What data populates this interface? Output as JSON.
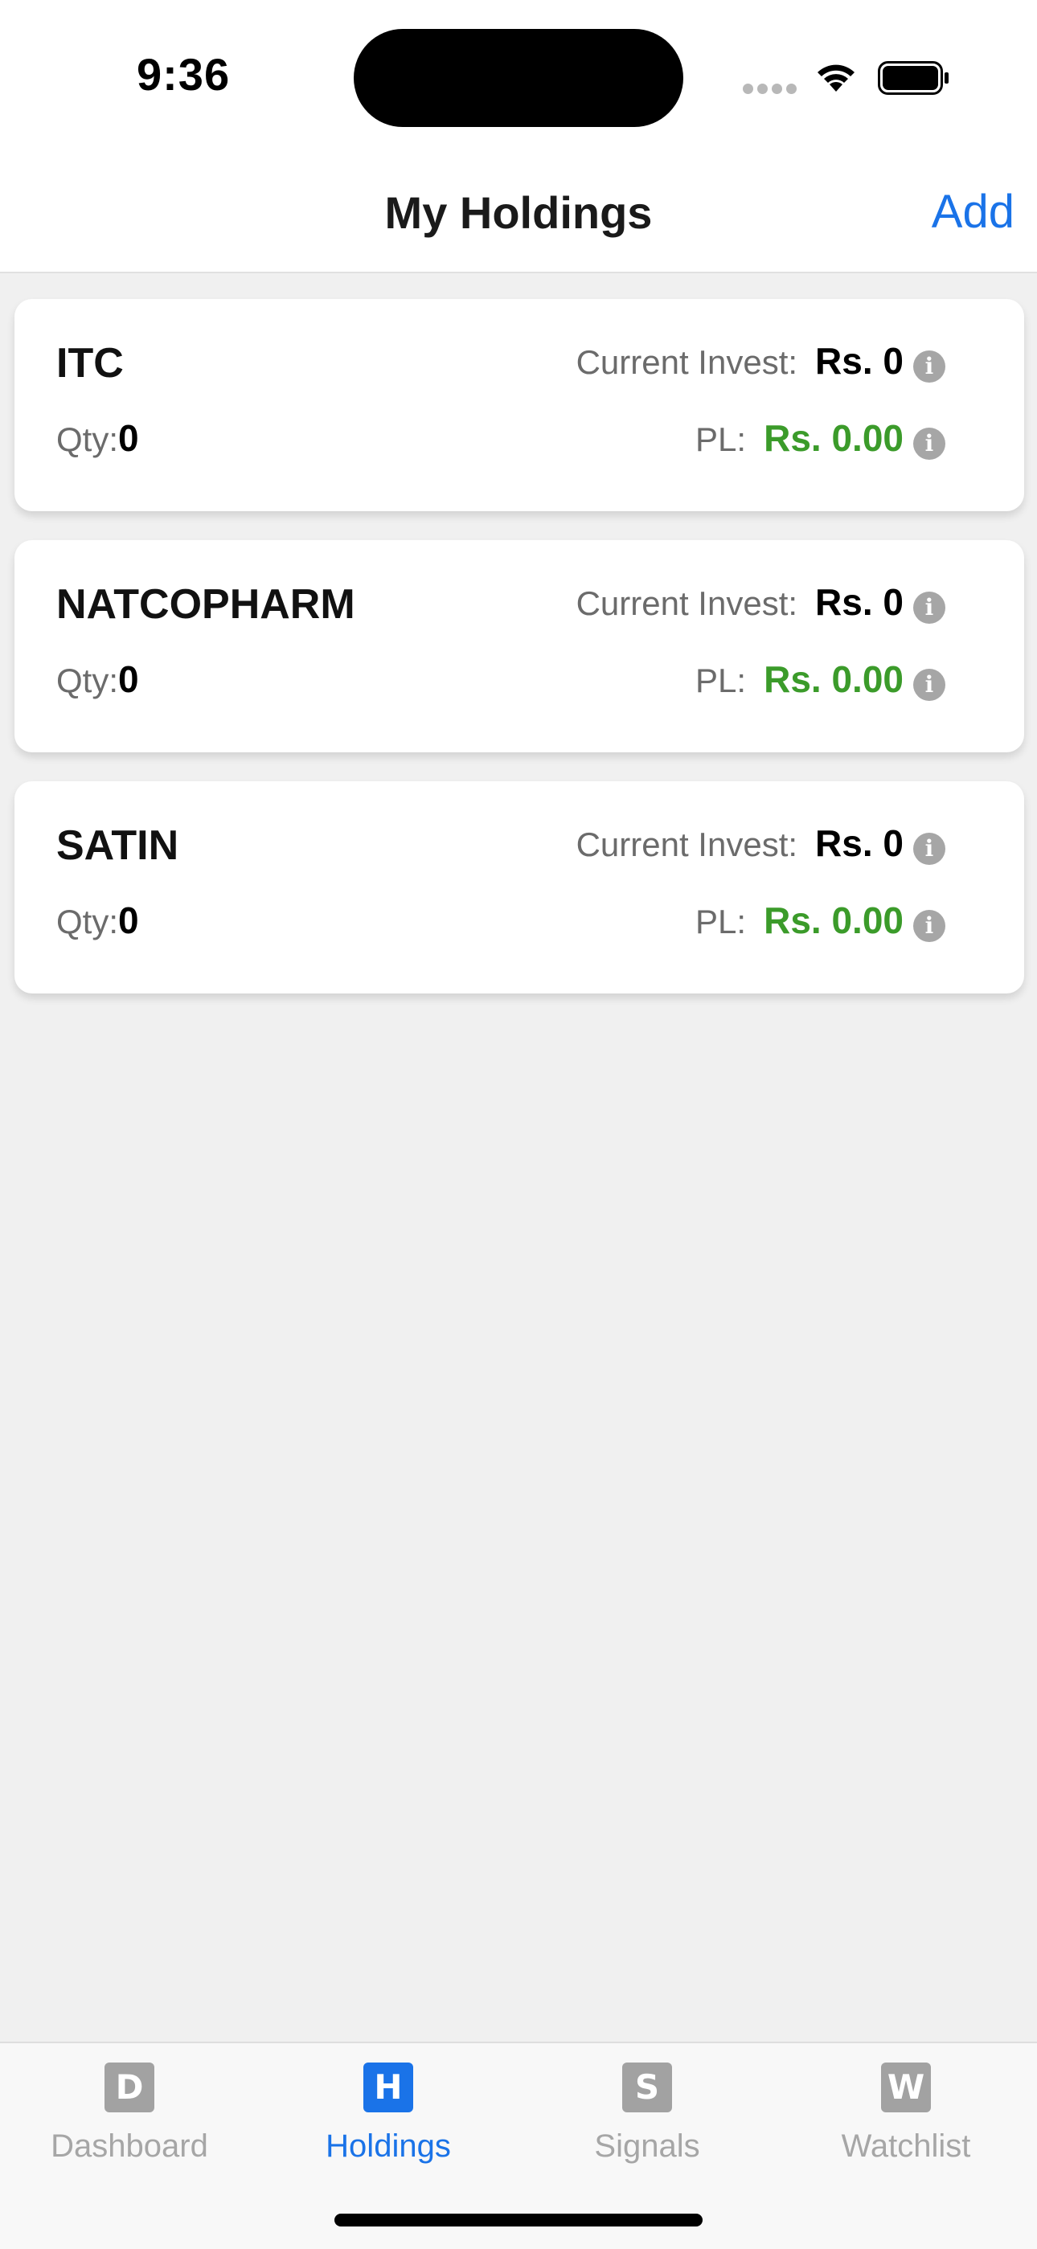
{
  "status_bar": {
    "time": "9:36"
  },
  "header": {
    "title": "My Holdings",
    "add_label": "Add"
  },
  "holdings": [
    {
      "symbol": "ITC",
      "qty_label": "Qty:",
      "qty": "0",
      "invest_label": "Current Invest:",
      "invest": "Rs. 0",
      "pl_label": "PL:",
      "pl": "Rs. 0.00"
    },
    {
      "symbol": "NATCOPHARM",
      "qty_label": "Qty:",
      "qty": "0",
      "invest_label": "Current Invest:",
      "invest": "Rs. 0",
      "pl_label": "PL:",
      "pl": "Rs. 0.00"
    },
    {
      "symbol": "SATIN",
      "qty_label": "Qty:",
      "qty": "0",
      "invest_label": "Current Invest:",
      "invest": "Rs. 0",
      "pl_label": "PL:",
      "pl": "Rs. 0.00"
    }
  ],
  "tabs": [
    {
      "label": "Dashboard",
      "icon_letter": "D",
      "icon": "dashboard-icon",
      "active": false
    },
    {
      "label": "Holdings",
      "icon_letter": "H",
      "icon": "holdings-icon",
      "active": true
    },
    {
      "label": "Signals",
      "icon_letter": "S",
      "icon": "signals-icon",
      "active": false
    },
    {
      "label": "Watchlist",
      "icon_letter": "W",
      "icon": "watchlist-icon",
      "active": false
    }
  ],
  "colors": {
    "accent": "#1a73e8",
    "profit": "#3b9b2a",
    "background": "#f0f0f0"
  }
}
